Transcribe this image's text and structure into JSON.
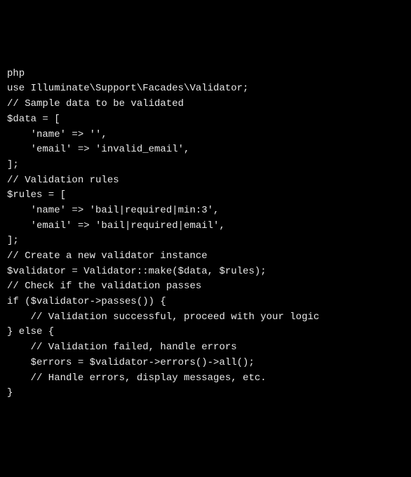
{
  "code": {
    "lines": [
      "php",
      "use Illuminate\\Support\\Facades\\Validator;",
      "",
      "// Sample data to be validated",
      "$data = [",
      "    'name' => '',",
      "    'email' => 'invalid_email',",
      "];",
      "",
      "// Validation rules",
      "$rules = [",
      "    'name' => 'bail|required|min:3',",
      "    'email' => 'bail|required|email',",
      "];",
      "",
      "// Create a new validator instance",
      "$validator = Validator::make($data, $rules);",
      "",
      "// Check if the validation passes",
      "if ($validator->passes()) {",
      "    // Validation successful, proceed with your logic",
      "} else {",
      "    // Validation failed, handle errors",
      "    $errors = $validator->errors()->all();",
      "    // Handle errors, display messages, etc.",
      "}"
    ]
  }
}
